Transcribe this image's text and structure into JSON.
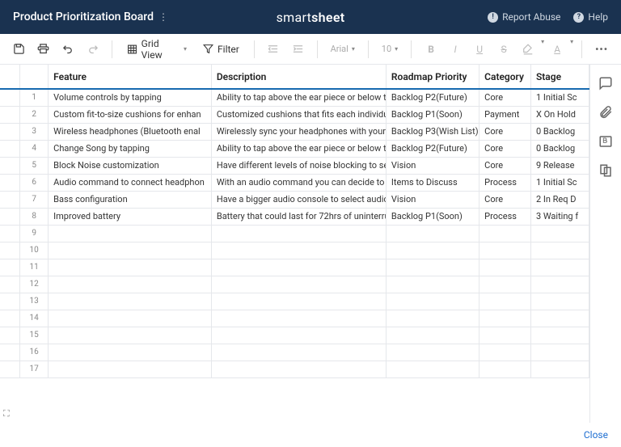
{
  "header": {
    "title": "Product Prioritization Board",
    "brand_light": "smart",
    "brand_bold": "sheet",
    "report_abuse": "Report Abuse",
    "help": "Help"
  },
  "toolbar": {
    "grid_view": "Grid View",
    "filter": "Filter",
    "font": "Arial",
    "size": "10"
  },
  "columns": [
    "Feature",
    "Description",
    "Roadmap Priority",
    "Category",
    "Stage"
  ],
  "rows": [
    {
      "n": 1,
      "feature": "Volume controls by tapping",
      "description": "Ability to tap above the ear piece or below t",
      "priority": "Backlog P2(Future)",
      "category": "Core",
      "stage": "1 Initial Sc"
    },
    {
      "n": 2,
      "feature": "Custom fit-to-size cushions for enhan",
      "description": "Customized cushions that fits each individu",
      "priority": "Backlog P1(Soon)",
      "category": "Payment",
      "stage": "X On Hold"
    },
    {
      "n": 3,
      "feature": "Wireless headphones (Bluetooth enal",
      "description": "Wirelessly sync your headphones with your",
      "priority": "Backlog P3(Wish List)",
      "category": "Core",
      "stage": "0 Backlog"
    },
    {
      "n": 4,
      "feature": "Change Song by tapping",
      "description": "Ability to tap above the ear piece or below t",
      "priority": "Backlog P2(Future)",
      "category": "Core",
      "stage": "0 Backlog"
    },
    {
      "n": 5,
      "feature": "Block Noise customization",
      "description": "Have different levels of noise blocking to se",
      "priority": "Vision",
      "category": "Core",
      "stage": "9 Release"
    },
    {
      "n": 6,
      "feature": "Audio command to connect headphon",
      "description": "With an audio command you can decide to",
      "priority": "Items to Discuss",
      "category": "Process",
      "stage": "1 Initial Sc"
    },
    {
      "n": 7,
      "feature": "Bass configuration",
      "description": "Have a bigger audio console to select audio",
      "priority": "Vision",
      "category": "Core",
      "stage": "2 In Req D"
    },
    {
      "n": 8,
      "feature": "Improved battery",
      "description": "Battery that could last for 72hrs of uninterru",
      "priority": "Backlog P1(Soon)",
      "category": "Process",
      "stage": "3 Waiting f"
    }
  ],
  "empty_rows": [
    9,
    10,
    11,
    12,
    13,
    14,
    15,
    16,
    17
  ],
  "footer": {
    "close": "Close"
  }
}
